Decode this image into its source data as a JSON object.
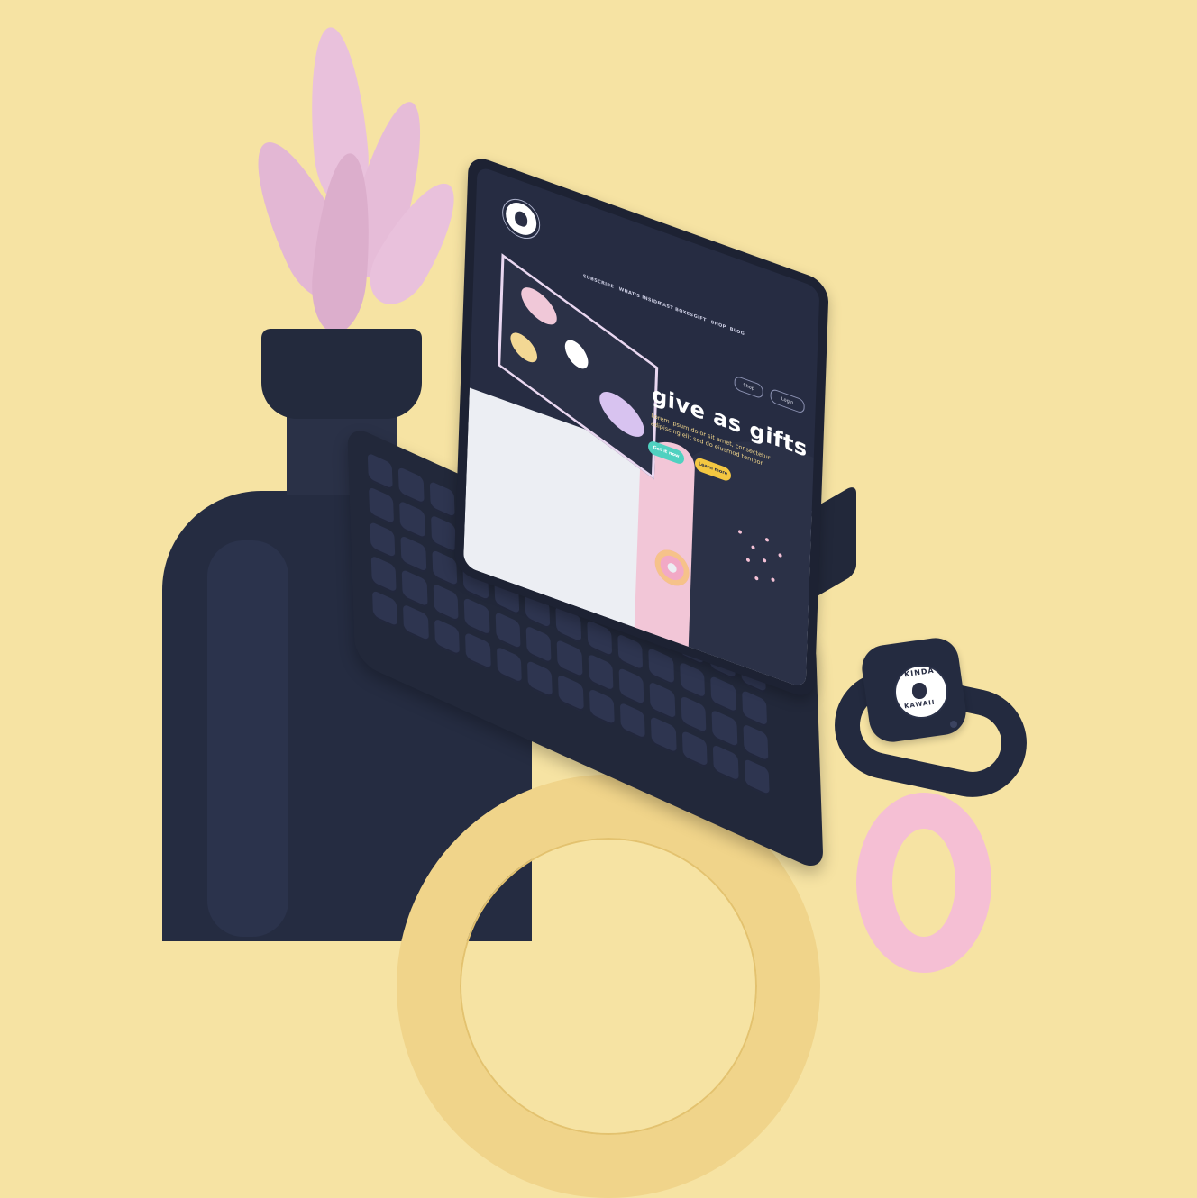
{
  "scene": {
    "background_color": "#f6e3a3",
    "object_color": "#232a3d",
    "accent_pink": "#f5bfd4",
    "accent_yellow": "#f0d48a"
  },
  "tablet_screen": {
    "nav_items": [
      "SUBSCRIBE",
      "WHAT'S INSIDE",
      "PAST BOXES",
      "GIFT",
      "SHOP",
      "BLOG"
    ],
    "shop_label": "Shop",
    "login_label": "Login",
    "hero_title": "give as gifts",
    "hero_subtitle": "Lorem ipsum dolor sit amet, consectetur adipiscing elit sed do eiusmod tempor.",
    "cta_primary": "Get it now",
    "cta_secondary": "Learn more"
  },
  "watch": {
    "logo_top": "KINDA",
    "logo_bottom": "KAWAII"
  }
}
